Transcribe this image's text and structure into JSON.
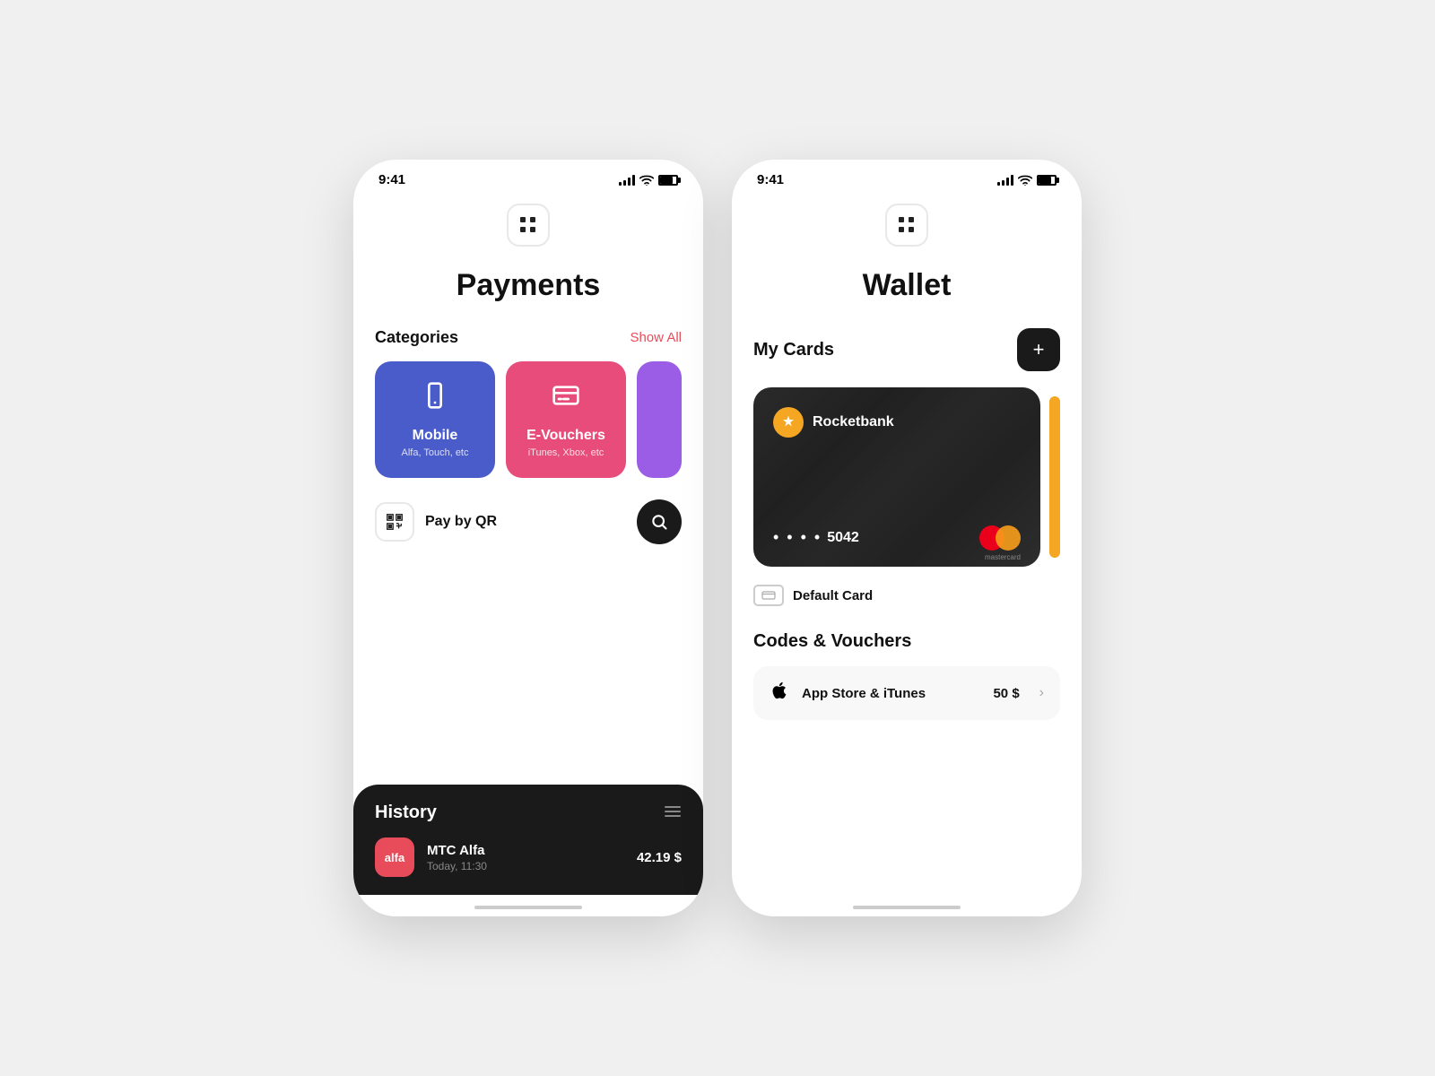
{
  "payments_screen": {
    "status_time": "9:41",
    "title": "Payments",
    "categories_label": "Categories",
    "show_all_label": "Show All",
    "categories": [
      {
        "id": "mobile",
        "name": "Mobile",
        "sub": "Alfa, Touch, etc",
        "color": "mobile"
      },
      {
        "id": "evouchers",
        "name": "E-Vouchers",
        "sub": "iTunes, Xbox, etc",
        "color": "evouchers"
      }
    ],
    "pay_qr_label": "Pay by QR",
    "history_title": "History",
    "history_items": [
      {
        "logo_text": "alfa",
        "name": "MTC Alfa",
        "date": "Today, 11:30",
        "amount": "42.19 $"
      }
    ]
  },
  "wallet_screen": {
    "status_time": "9:41",
    "title": "Wallet",
    "my_cards_label": "My Cards",
    "add_card_label": "+",
    "card": {
      "bank": "Rocketbank",
      "dots": "• • • •",
      "last4": "5042",
      "network": "mastercard"
    },
    "default_card_label": "Default Card",
    "codes_title": "Codes & Vouchers",
    "vouchers": [
      {
        "icon": "apple",
        "name": "App Store & iTunes",
        "amount": "50 $"
      }
    ]
  },
  "icons": {
    "signal": "signal",
    "wifi": "wifi",
    "battery": "battery",
    "grid": "grid",
    "search": "search",
    "qr": "qr",
    "three_lines": "menu",
    "chevron": "chevron-right"
  }
}
